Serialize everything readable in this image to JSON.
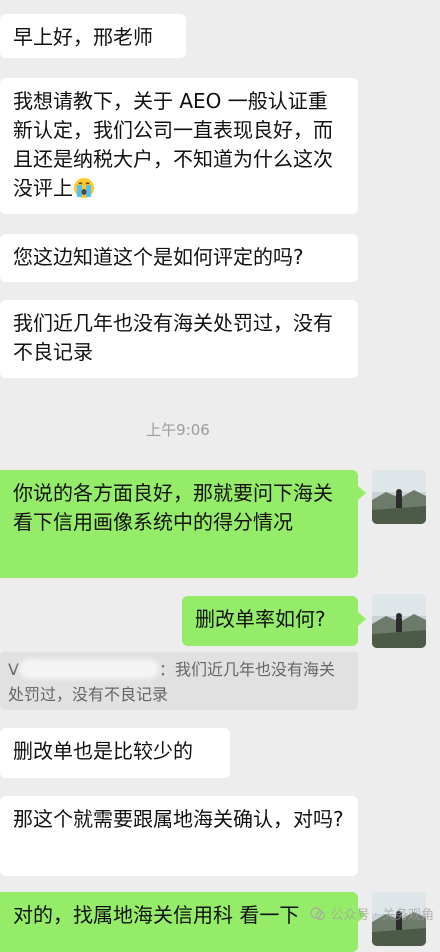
{
  "messages": {
    "m1": "早上好，邢老师",
    "m2": "我想请教下，关于 AEO 一般认证重新认定，我们公司一直表现良好，而且还是纳税大户，不知道为什么这次没评上",
    "m3": "您这边知道这个是如何评定的吗?",
    "m4": "我们近几年也没有海关处罚过，没有不良记录",
    "m5": "你说的各方面良好，那就要问下海关 看下信用画像系统中的得分情况",
    "m6": "删改单率如何?",
    "m7_prefix": "V",
    "m7_after": "：我们近几年也没有海关处罚过，没有不良记录",
    "m8": "删改单也是比较少的",
    "m9": "那这个就需要跟属地海关确认，对吗?",
    "m10": "对的，找属地海关信用科 看一下"
  },
  "time_divider": "上午9:06",
  "watermark": "公众号 · 关务观角",
  "colors": {
    "background": "#ededed",
    "incoming_bubble": "#ffffff",
    "outgoing_bubble": "#95ec69",
    "quote_bg": "#e1e1e1"
  },
  "icons": {
    "emoji": "crying-face-emoji",
    "avatar": "mountain-photo-avatar"
  }
}
